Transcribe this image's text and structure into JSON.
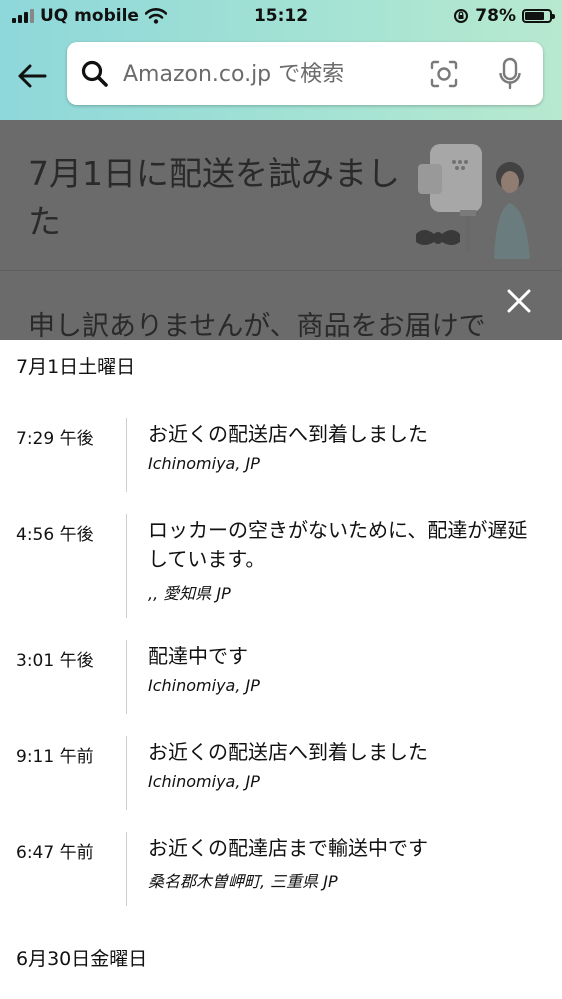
{
  "status_bar": {
    "carrier": "UQ mobile",
    "time": "15:12",
    "battery": "78%"
  },
  "search": {
    "placeholder": "Amazon.co.jp で検索"
  },
  "banner": {
    "title": "7月1日に配送を試みました",
    "subtitle": "申し訳ありませんが、商品をお届けで"
  },
  "tracking": {
    "days": [
      {
        "heading": "7月1日土曜日",
        "events": [
          {
            "time": "7:29 午後",
            "description": "お近くの配送店へ到着しました",
            "location": "Ichinomiya, JP"
          },
          {
            "time": "4:56 午後",
            "description": "ロッカーの空きがないために、配達が遅延しています。",
            "location": ",, 愛知県 JP"
          },
          {
            "time": "3:01 午後",
            "description": "配達中です",
            "location": "Ichinomiya, JP"
          },
          {
            "time": "9:11 午前",
            "description": "お近くの配送店へ到着しました",
            "location": "Ichinomiya, JP"
          },
          {
            "time": "6:47 午前",
            "description": "お近くの配達店まで輸送中です",
            "location": "桑名郡木曽岬町, 三重県 JP"
          }
        ]
      },
      {
        "heading": "6月30日金曜日",
        "events": []
      }
    ]
  },
  "icons": {
    "back": "back-arrow-icon",
    "search": "search-icon",
    "camera": "camera-icon",
    "mic": "microphone-icon",
    "close": "close-icon"
  },
  "colors": {
    "header_gradient_start": "#8ed7da",
    "header_gradient_end": "#b8e9cf",
    "overlay": "#6b6b6b"
  }
}
